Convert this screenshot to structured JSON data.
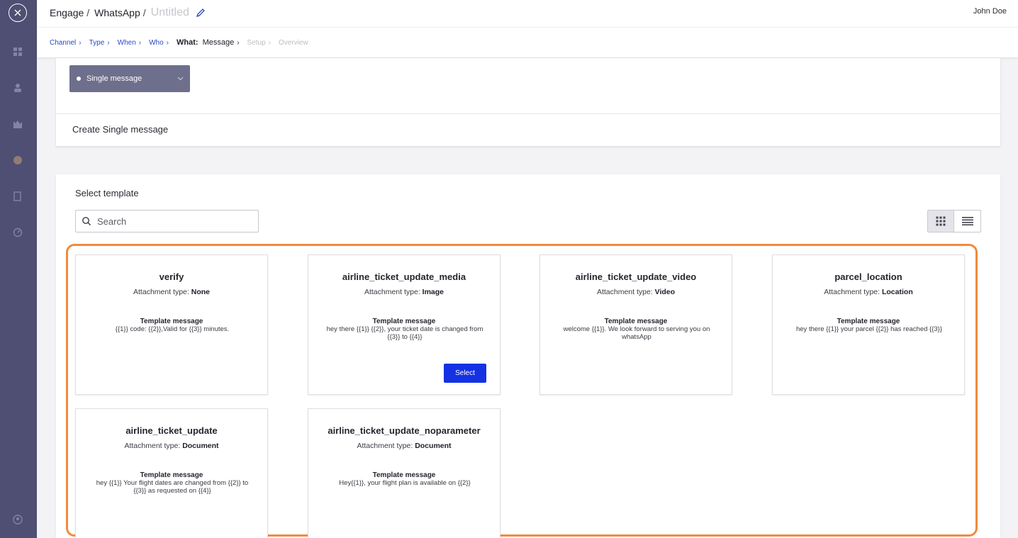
{
  "header": {
    "breadcrumb": [
      "Engage",
      "WhatsApp"
    ],
    "title": "Untitled",
    "user": "John Doe"
  },
  "steps": [
    {
      "label": "Channel",
      "state": "done"
    },
    {
      "label": "Type",
      "state": "done"
    },
    {
      "label": "When",
      "state": "done"
    },
    {
      "label": "Who",
      "state": "done"
    },
    {
      "label": "What:",
      "sublabel": "Message",
      "state": "current"
    },
    {
      "label": "Setup",
      "state": "disabled"
    },
    {
      "label": "Overview",
      "state": "disabled"
    }
  ],
  "message_type": {
    "selected": "Single message",
    "create_label": "Create Single message"
  },
  "templates_section": {
    "title": "Select template",
    "search_placeholder": "Search",
    "select_label": "Select",
    "message_heading": "Template message",
    "attachment_prefix": "Attachment type:"
  },
  "templates": [
    {
      "name": "verify",
      "attachment": "None",
      "message": "{{1}} code: {{2}},Valid for {{3}} minutes."
    },
    {
      "name": "airline_ticket_update_media",
      "attachment": "Image",
      "message": "hey there {{1}} {{2}}, your ticket date is changed from {{3}} to {{4}}"
    },
    {
      "name": "airline_ticket_update_video",
      "attachment": "Video",
      "message": "welcome {{1}}. We look forward to serving you on whatsApp"
    },
    {
      "name": "parcel_location",
      "attachment": "Location",
      "message": "hey there {{1}} your parcel {{2}} has reached {{3}}"
    },
    {
      "name": "airline_ticket_update",
      "attachment": "Document",
      "message": "hey {{1}} Your flight dates are changed from {{2}} to {{3}} as requested on {{4}}"
    },
    {
      "name": "airline_ticket_update_noparameter",
      "attachment": "Document",
      "message": "Hey{{1}}, your flight plan is available on {{2}}"
    }
  ],
  "colors": {
    "rail": "#4e4f73",
    "accent_link": "#2949c7",
    "select_button": "#1432e3",
    "highlight_border": "#f08a3e",
    "dropdown": "#6e6f8c"
  }
}
